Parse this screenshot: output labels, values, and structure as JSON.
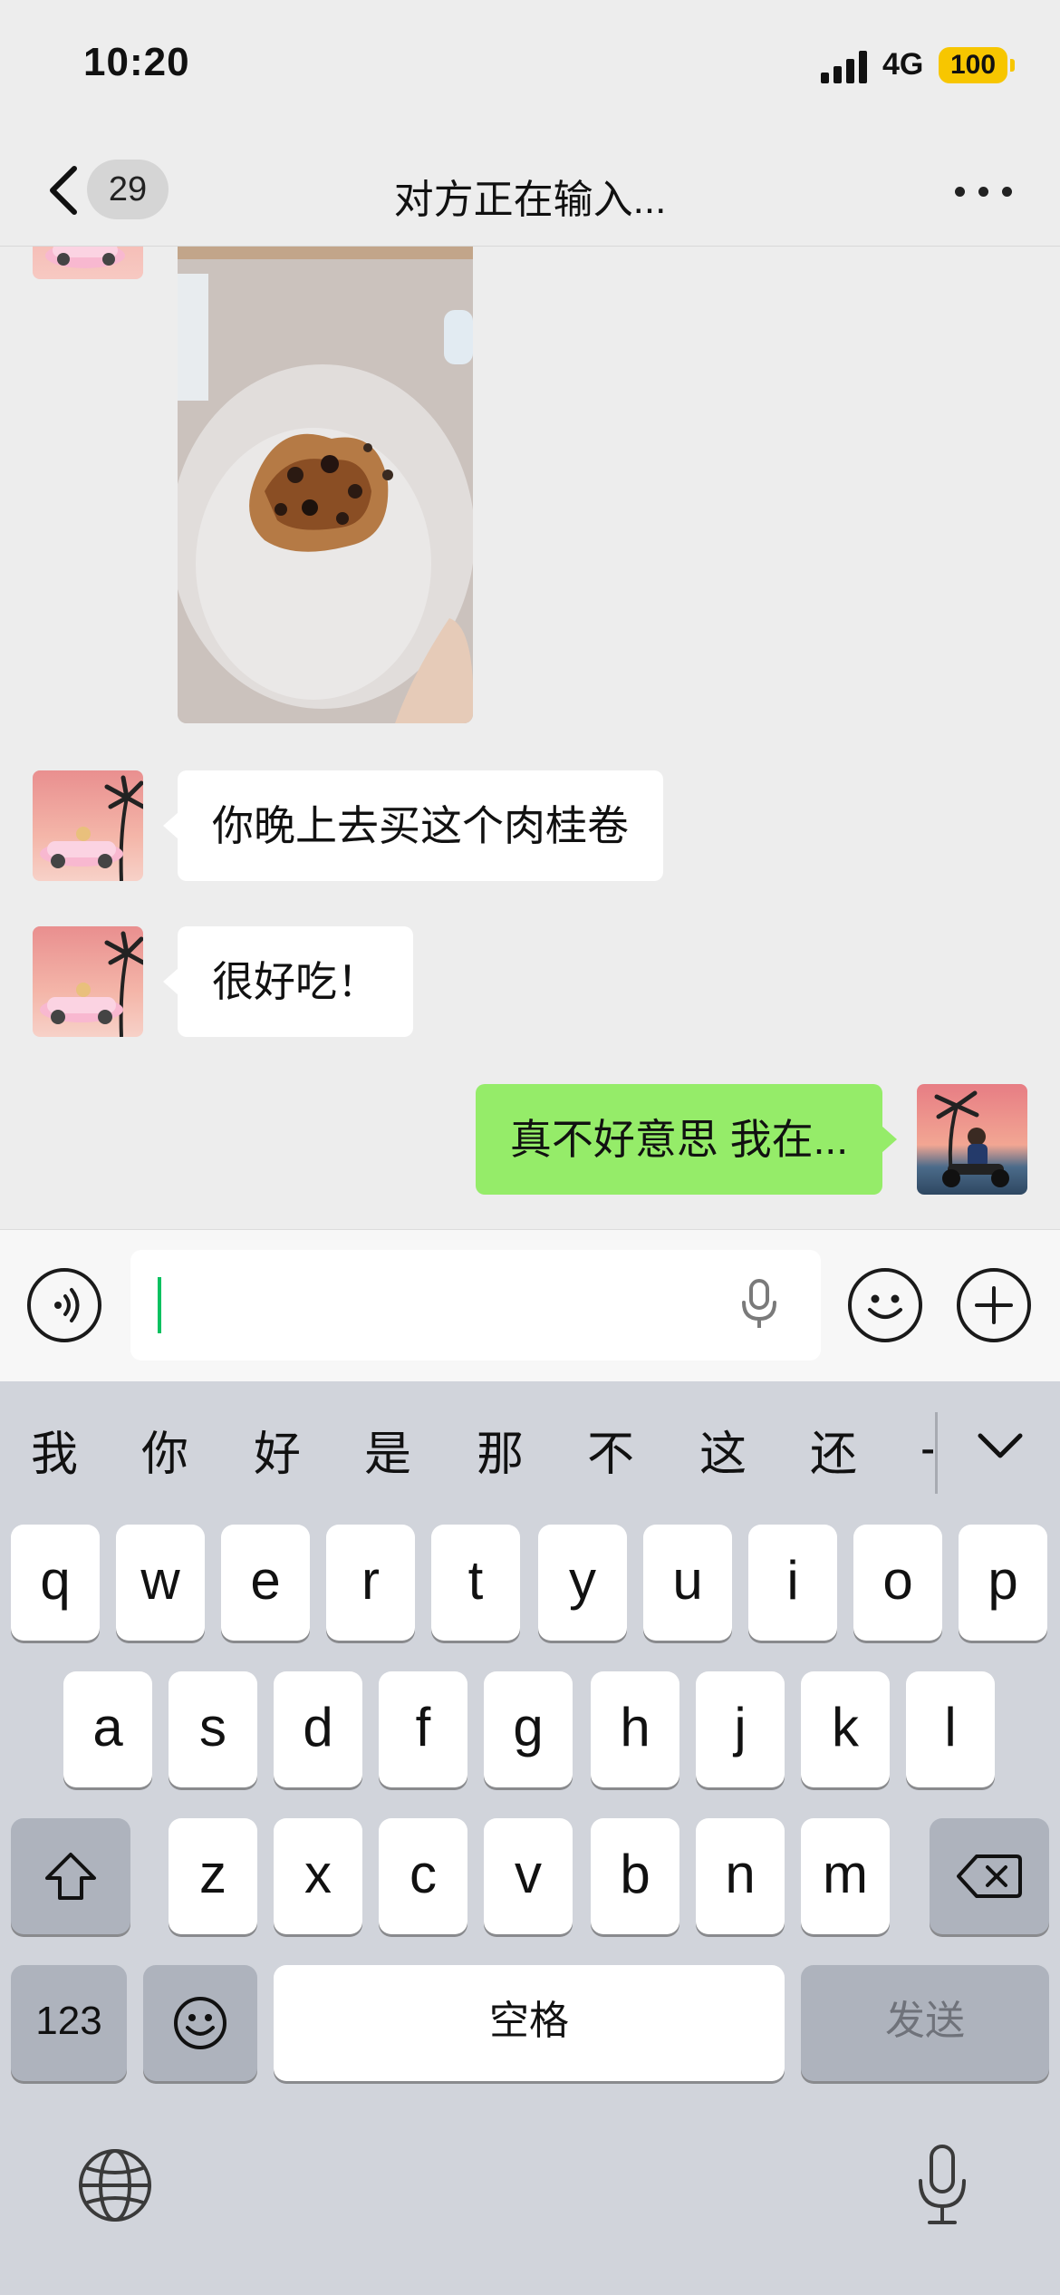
{
  "status_bar": {
    "time": "10:20",
    "network": "4G",
    "battery": "100"
  },
  "nav": {
    "unread_count": "29",
    "title": "对方正在输入..."
  },
  "messages": [
    {
      "from": "other",
      "type": "image"
    },
    {
      "from": "other",
      "type": "text",
      "text": "你晚上去买这个肉桂卷"
    },
    {
      "from": "other",
      "type": "text",
      "text": "很好吃！"
    },
    {
      "from": "me",
      "type": "text",
      "text": "真不好意思 我在..."
    }
  ],
  "input": {
    "value": ""
  },
  "keyboard": {
    "candidates": [
      "我",
      "你",
      "好",
      "是",
      "那",
      "不",
      "这",
      "还",
      "一"
    ],
    "row1": [
      "q",
      "w",
      "e",
      "r",
      "t",
      "y",
      "u",
      "i",
      "o",
      "p"
    ],
    "row2": [
      "a",
      "s",
      "d",
      "f",
      "g",
      "h",
      "j",
      "k",
      "l"
    ],
    "row3": [
      "z",
      "x",
      "c",
      "v",
      "b",
      "n",
      "m"
    ],
    "num_key": "123",
    "space_key": "空格",
    "send_key": "发送"
  },
  "colors": {
    "out_bubble": "#95ec69",
    "in_bubble": "#ffffff",
    "caret": "#07c160",
    "battery": "#f7c600"
  }
}
